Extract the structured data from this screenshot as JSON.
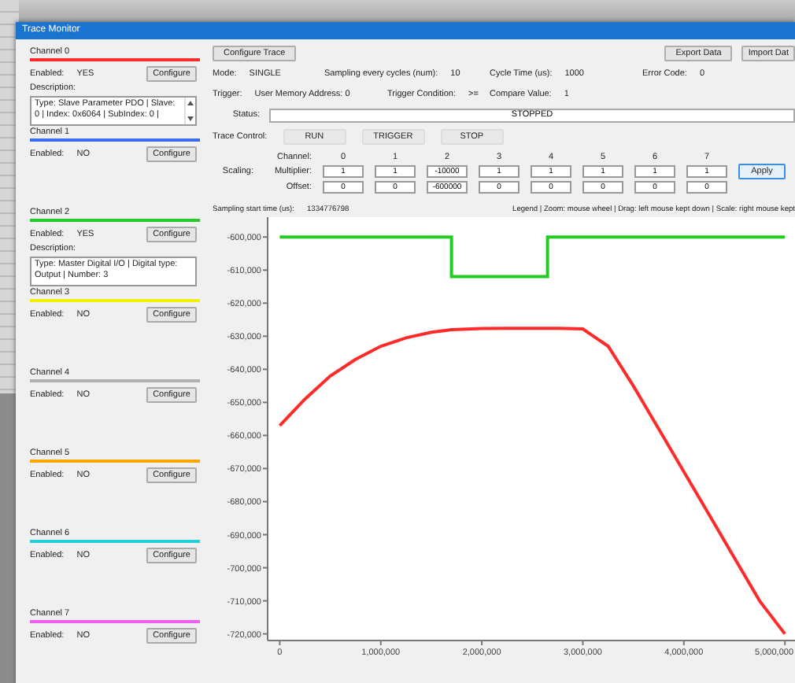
{
  "window": {
    "title": "Trace Monitor"
  },
  "channels": [
    {
      "title": "Channel 0",
      "color": "#ff2a2a",
      "enabled_label": "Enabled:",
      "enabled": "YES",
      "button": "Configure",
      "description_label": "Description:",
      "description": "Type: Slave Parameter PDO | Slave: 0 | Index: 0x6064 | SubIndex: 0 |",
      "scrollable": true
    },
    {
      "title": "Channel 1",
      "color": "#3a6cf0",
      "enabled_label": "Enabled:",
      "enabled": "NO",
      "button": "Configure"
    },
    {
      "title": "Channel 2",
      "color": "#22cc22",
      "enabled_label": "Enabled:",
      "enabled": "YES",
      "button": "Configure",
      "description_label": "Description:",
      "description": "Type: Master Digital I/O | Digital type: Output | Number: 3",
      "scrollable": false
    },
    {
      "title": "Channel 3",
      "color": "#f2f200",
      "enabled_label": "Enabled:",
      "enabled": "NO",
      "button": "Configure"
    },
    {
      "title": "Channel 4",
      "color": "#b0b0b0",
      "enabled_label": "Enabled:",
      "enabled": "NO",
      "button": "Configure"
    },
    {
      "title": "Channel 5",
      "color": "#ffa500",
      "enabled_label": "Enabled:",
      "enabled": "NO",
      "button": "Configure"
    },
    {
      "title": "Channel 6",
      "color": "#20d0d8",
      "enabled_label": "Enabled:",
      "enabled": "NO",
      "button": "Configure"
    },
    {
      "title": "Channel 7",
      "color": "#f060f0",
      "enabled_label": "Enabled:",
      "enabled": "NO",
      "button": "Configure"
    }
  ],
  "toolbar": {
    "configure": "Configure Trace",
    "export": "Export Data",
    "import": "Import Dat"
  },
  "info_rows": [
    [
      {
        "label": "Mode:",
        "value": "SINGLE"
      },
      {
        "label": "Sampling every cycles (num):",
        "value": "10"
      },
      {
        "label": "Cycle Time (us):",
        "value": "1000"
      },
      {
        "label": "Error Code:",
        "value": "0"
      }
    ],
    [
      {
        "label": "Trigger:",
        "value": "User Memory Address: 0"
      },
      {
        "label": "Trigger Condition:",
        "value": ">="
      },
      {
        "label": "Compare Value:",
        "value": "1"
      }
    ]
  ],
  "status": {
    "label": "Status:",
    "value": "STOPPED"
  },
  "trace_control": {
    "label": "Trace Control:",
    "buttons": [
      "RUN",
      "TRIGGER",
      "STOP"
    ]
  },
  "scaling": {
    "label": "Scaling:",
    "channel_label": "Channel:",
    "multiplier_label": "Multiplier:",
    "offset_label": "Offset:",
    "channels": [
      "0",
      "1",
      "2",
      "3",
      "4",
      "5",
      "6",
      "7"
    ],
    "multipliers": [
      "1",
      "1",
      "-10000",
      "1",
      "1",
      "1",
      "1",
      "1"
    ],
    "offsets": [
      "0",
      "0",
      "-600000",
      "0",
      "0",
      "0",
      "0",
      "0"
    ],
    "apply": "Apply"
  },
  "chart": {
    "start_label": "Sampling start time (us):",
    "start_value": "1334776798",
    "legend": "Legend | Zoom: mouse wheel | Drag: left mouse kept down | Scale: right mouse kept",
    "chart_data": {
      "type": "line",
      "x": [
        0,
        250000,
        500000,
        750000,
        1000000,
        1250000,
        1500000,
        1700000,
        1700000,
        2000000,
        2250000,
        2500000,
        2650000,
        2650000,
        2750000,
        3000000,
        3250000,
        3500000,
        3750000,
        4000000,
        4250000,
        4500000,
        4750000,
        5000000
      ],
      "series": [
        {
          "color": "#ff2a2a",
          "values": [
            -657000,
            -649000,
            -642000,
            -637000,
            -633000,
            -630500,
            -628800,
            -628000,
            -628000,
            -627700,
            -627600,
            -627600,
            -627600,
            -627600,
            -627600,
            -627800,
            -633000,
            -645000,
            -658000,
            -671000,
            -684000,
            -697000,
            -710000,
            -720000
          ]
        },
        {
          "color": "#22cc22",
          "values": [
            -600000,
            -600000,
            -600000,
            -600000,
            -600000,
            -600000,
            -600000,
            -600000,
            -612000,
            -612000,
            -612000,
            -612000,
            -612000,
            -600000,
            -600000,
            -600000,
            -600000,
            -600000,
            -600000,
            -600000,
            -600000,
            -600000,
            -600000,
            -600000
          ]
        }
      ],
      "xlim": [
        -120000,
        5100000
      ],
      "ylim": [
        -722000,
        -594000
      ],
      "xticks": [
        {
          "value": 0,
          "label": "0"
        },
        {
          "value": 1000000,
          "label": "1,000,000"
        },
        {
          "value": 2000000,
          "label": "2,000,000"
        },
        {
          "value": 3000000,
          "label": "3,000,000"
        },
        {
          "value": 4000000,
          "label": "4,000,000"
        },
        {
          "value": 5000000,
          "label": "5,000,000"
        }
      ],
      "yticks": [
        {
          "value": -600000,
          "label": "-600,000"
        },
        {
          "value": -610000,
          "label": "-610,000"
        },
        {
          "value": -620000,
          "label": "-620,000"
        },
        {
          "value": -630000,
          "label": "-630,000"
        },
        {
          "value": -640000,
          "label": "-640,000"
        },
        {
          "value": -650000,
          "label": "-650,000"
        },
        {
          "value": -660000,
          "label": "-660,000"
        },
        {
          "value": -670000,
          "label": "-670,000"
        },
        {
          "value": -680000,
          "label": "-680,000"
        },
        {
          "value": -690000,
          "label": "-690,000"
        },
        {
          "value": -700000,
          "label": "-700,000"
        },
        {
          "value": -710000,
          "label": "-710,000"
        },
        {
          "value": -720000,
          "label": "-720,000"
        }
      ]
    }
  }
}
